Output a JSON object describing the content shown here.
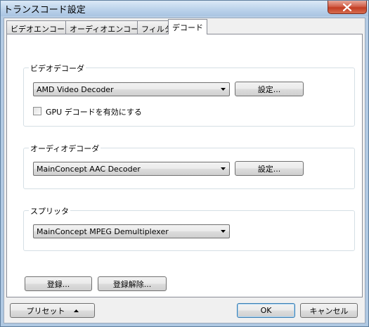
{
  "window": {
    "title": "トランスコード設定"
  },
  "tabs": [
    {
      "label": "ビデオエンコード"
    },
    {
      "label": "オーディオエンコード"
    },
    {
      "label": "フィルタ"
    },
    {
      "label": "デコード"
    }
  ],
  "video_decoder": {
    "group_label": "ビデオデコーダ",
    "selected": "AMD Video Decoder",
    "settings_label": "設定...",
    "gpu_checkbox_label": "GPU デコードを有効にする",
    "gpu_checked": false
  },
  "audio_decoder": {
    "group_label": "オーディオデコーダ",
    "selected": "MainConcept AAC Decoder",
    "settings_label": "設定..."
  },
  "splitter": {
    "group_label": "スプリッタ",
    "selected": "MainConcept MPEG Demultiplexer"
  },
  "register": {
    "register_label": "登録...",
    "unregister_label": "登録解除..."
  },
  "footer": {
    "preset_label": "プリセット",
    "ok_label": "OK",
    "cancel_label": "キャンセル"
  }
}
